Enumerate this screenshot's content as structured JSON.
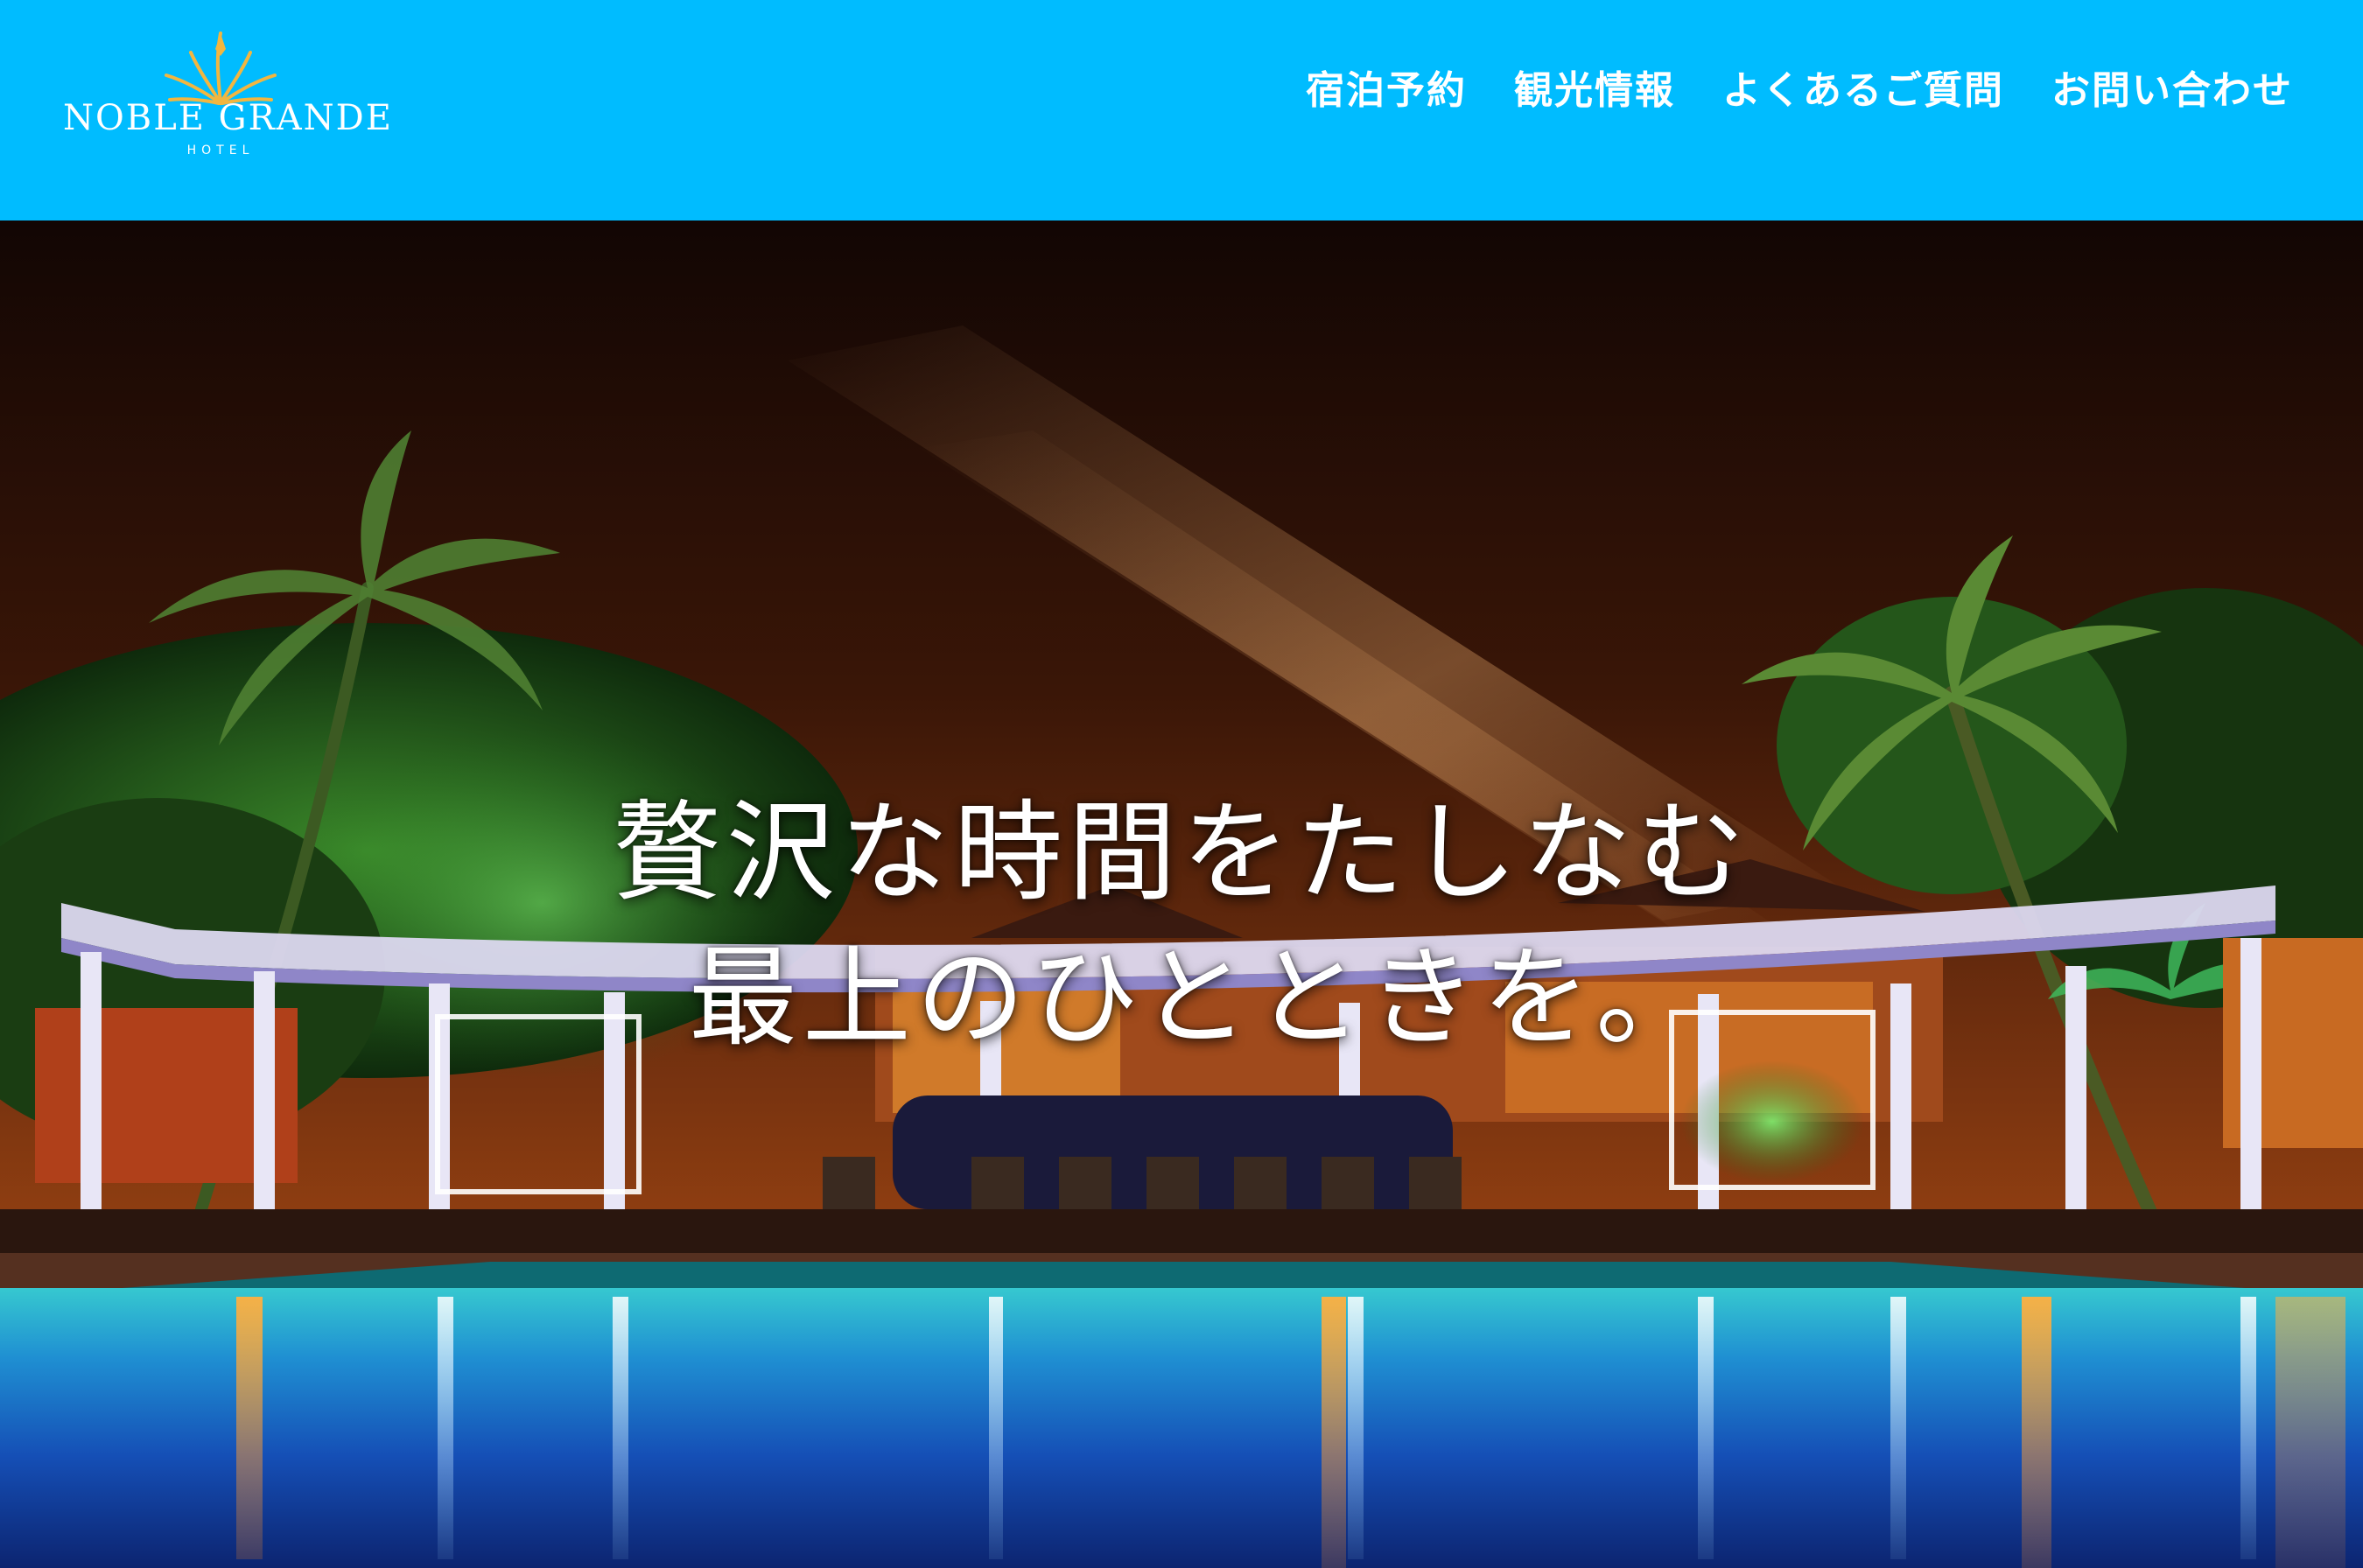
{
  "colors": {
    "header_bg": "#00bcff",
    "nav_text": "#ffffff",
    "logo_gold": "#f2b640"
  },
  "logo": {
    "icon": "palm-leaf-icon",
    "name": "NOBLE GRANDE",
    "sub": "HOTEL"
  },
  "nav": {
    "items": [
      {
        "label": "宿泊予約"
      },
      {
        "label": "観光情報"
      },
      {
        "label": "よくあるご質問"
      },
      {
        "label": "お問い合わせ"
      }
    ]
  },
  "hero": {
    "line1": "贅沢な時間をたしなむ",
    "line2": "最上のひとときを。"
  }
}
